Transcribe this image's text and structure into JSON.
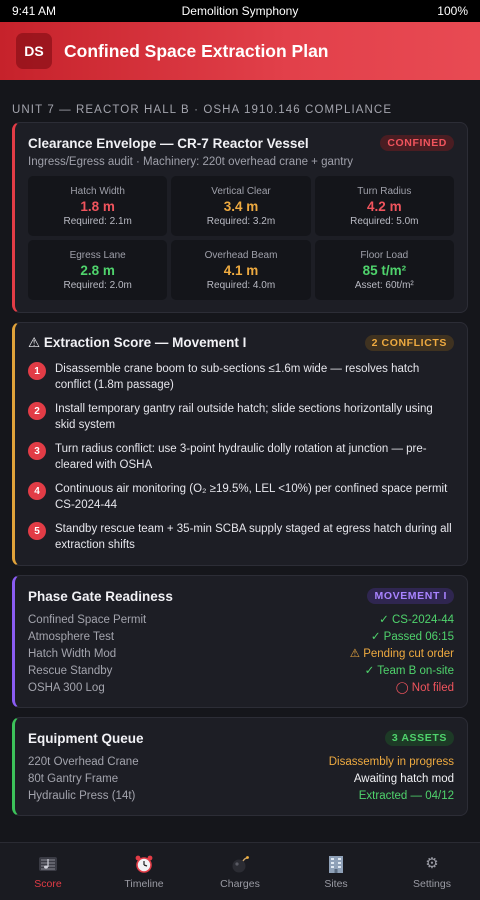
{
  "status_bar": {
    "time": "9:41 AM",
    "app": "Demolition Symphony",
    "battery": "100%"
  },
  "header": {
    "logo": "DS",
    "title": "Confined Space Extraction Plan"
  },
  "section_label": "UNIT 7 — REACTOR HALL B · OSHA 1910.146 COMPLIANCE",
  "clearance": {
    "title": "Clearance Envelope — CR-7 Reactor Vessel",
    "badge": "CONFINED",
    "subtitle": "Ingress/Egress audit · Machinery: 220t overhead crane + gantry",
    "tiles": [
      {
        "label": "Hatch Width",
        "value": "1.8 m",
        "note": "Required: 2.1m",
        "color": "red"
      },
      {
        "label": "Vertical Clear",
        "value": "3.4 m",
        "note": "Required: 3.2m",
        "color": "orange"
      },
      {
        "label": "Turn Radius",
        "value": "4.2 m",
        "note": "Required: 5.0m",
        "color": "red"
      },
      {
        "label": "Egress Lane",
        "value": "2.8 m",
        "note": "Required: 2.0m",
        "color": "green"
      },
      {
        "label": "Overhead Beam",
        "value": "4.1 m",
        "note": "Required: 4.0m",
        "color": "orange"
      },
      {
        "label": "Floor Load",
        "value": "85 t/m²",
        "note": "Asset: 60t/m²",
        "color": "green"
      }
    ]
  },
  "extraction": {
    "title": "⚠ Extraction Score — Movement I",
    "badge": "2 CONFLICTS",
    "steps": [
      {
        "num": "1",
        "text": "Disassemble crane boom to sub-sections ≤1.6m wide — resolves hatch conflict (1.8m passage)"
      },
      {
        "num": "2",
        "text": "Install temporary gantry rail outside hatch; slide sections horizontally using skid system"
      },
      {
        "num": "3",
        "text": "Turn radius conflict: use 3-point hydraulic dolly rotation at junction — pre-cleared with OSHA"
      },
      {
        "num": "4",
        "text": "Continuous air monitoring (O₂ ≥19.5%, LEL <10%) per confined space permit CS-2024-44"
      },
      {
        "num": "5",
        "text": "Standby rescue team + 35-min SCBA supply staged at egress hatch during all extraction shifts"
      }
    ]
  },
  "phase_gate": {
    "title": "Phase Gate Readiness",
    "badge": "MOVEMENT I",
    "rows": [
      {
        "key": "Confined Space Permit",
        "value": "✓ CS-2024-44",
        "color": "green"
      },
      {
        "key": "Atmosphere Test",
        "value": "✓ Passed 06:15",
        "color": "green"
      },
      {
        "key": "Hatch Width Mod",
        "value": "⚠ Pending cut order",
        "color": "orange"
      },
      {
        "key": "Rescue Standby",
        "value": "✓ Team B on-site",
        "color": "green"
      },
      {
        "key": "OSHA 300 Log",
        "value": "◯ Not filed",
        "color": "red"
      }
    ]
  },
  "equipment": {
    "title": "Equipment Queue",
    "badge": "3 ASSETS",
    "rows": [
      {
        "key": "220t Overhead Crane",
        "value": "Disassembly in progress",
        "color": "orange"
      },
      {
        "key": "80t Gantry Frame",
        "value": "Awaiting hatch mod",
        "color": "white"
      },
      {
        "key": "Hydraulic Press (14t)",
        "value": "Extracted — 04/12",
        "color": "green"
      }
    ]
  },
  "tabs": [
    {
      "label": "Score",
      "icon": "music-score-icon",
      "active": true
    },
    {
      "label": "Timeline",
      "icon": "alarm-clock-icon",
      "active": false
    },
    {
      "label": "Charges",
      "icon": "bomb-icon",
      "active": false
    },
    {
      "label": "Sites",
      "icon": "building-icon",
      "active": false
    },
    {
      "label": "Settings",
      "icon": "gear-icon",
      "active": false
    }
  ],
  "colors": {
    "accent": "#e23c46",
    "warning": "#eeaa40",
    "ok": "#4fd36c",
    "purple": "#8a5cf2"
  }
}
